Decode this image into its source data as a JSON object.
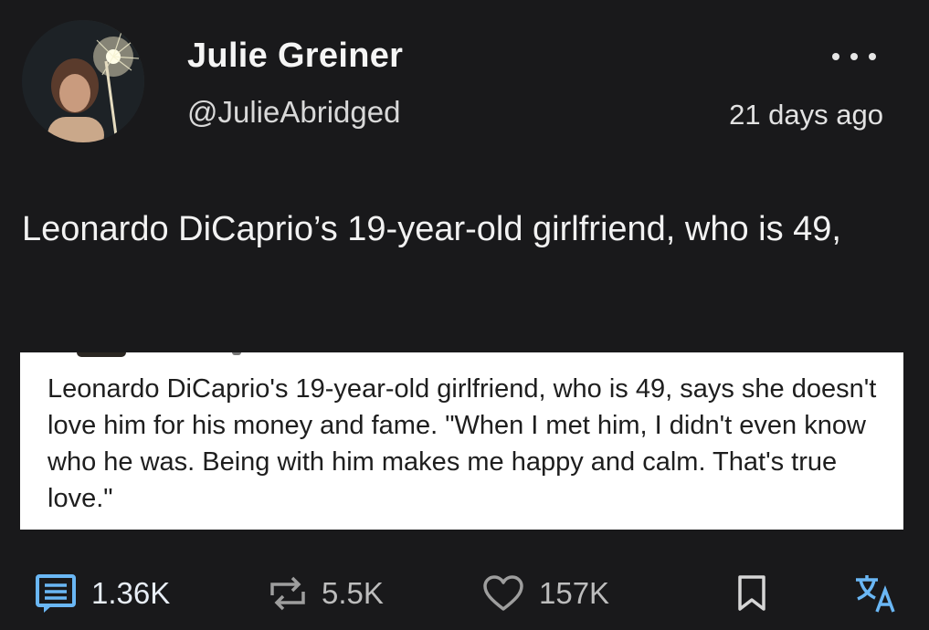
{
  "post": {
    "author": {
      "display_name": "Julie Greiner",
      "handle": "@JulieAbridged"
    },
    "timestamp": "21 days ago",
    "text": "Leonardo DiCaprio’s 19-year-old girlfriend, who is 49,",
    "quoted_image_text": "Leonardo DiCaprio's 19-year-old girlfriend, who is 49, says she doesn't love him for his money and fame. \"When I met him, I didn't even know who he was. Being with him makes me happy and calm. That's true love.\""
  },
  "actions": {
    "comments": {
      "count": "1.36K",
      "icon": "comment-icon"
    },
    "reposts": {
      "count": "5.5K",
      "icon": "repost-icon"
    },
    "likes": {
      "count": "157K",
      "icon": "heart-icon"
    },
    "bookmark": {
      "icon": "bookmark-icon"
    },
    "translate": {
      "icon": "translate-icon"
    },
    "more": {
      "icon": "more-icon"
    }
  },
  "colors": {
    "background": "#19191b",
    "text": "#f2f2f2",
    "accent": "#6ab7f5",
    "muted": "#bdbdbd"
  }
}
